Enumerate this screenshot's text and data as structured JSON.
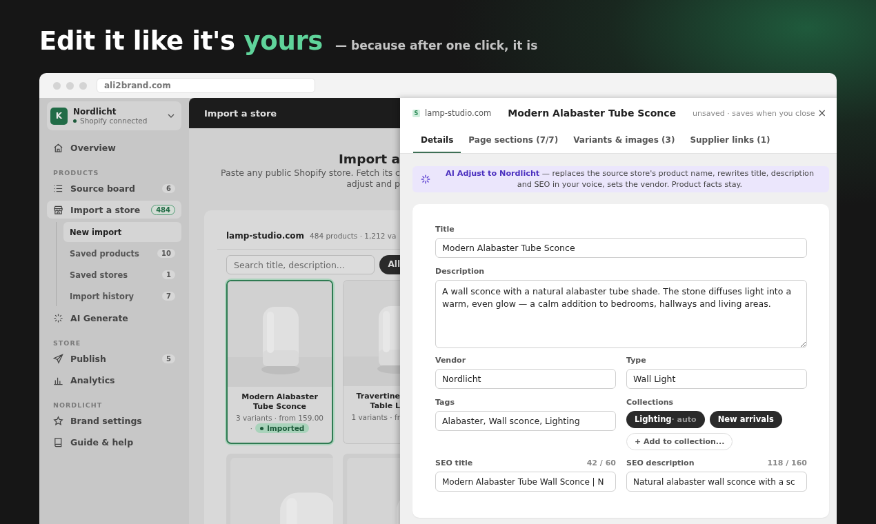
{
  "headline": {
    "parts": [
      {
        "text": "Edit it like it's",
        "accent": false
      },
      {
        "text": "yours",
        "accent": true
      }
    ],
    "tagline": "— because after one click, it is"
  },
  "browser": {
    "url": "ali2brand.com"
  },
  "sidebar": {
    "workspace": {
      "initial": "K",
      "name": "Nordlicht",
      "status": "Shopify connected"
    },
    "sections": [
      {
        "items": [
          {
            "label": "Overview",
            "selected": false
          }
        ]
      },
      {
        "heading": "PRODUCTS",
        "items": [
          {
            "label": "Source board",
            "badge": "6",
            "selected": false
          },
          {
            "label": "Import a store",
            "badge": "484",
            "selected": true,
            "children": [
              {
                "label": "New import",
                "selected": true
              },
              {
                "label": "Saved products",
                "badge": "10",
                "selected": false
              },
              {
                "label": "Saved stores",
                "badge": "1",
                "selected": false
              },
              {
                "label": "Import history",
                "badge": "7",
                "selected": false
              }
            ]
          },
          {
            "label": "AI Generate",
            "selected": false
          }
        ]
      },
      {
        "heading": "STORE",
        "items": [
          {
            "label": "Publish",
            "badge": "5",
            "selected": false
          },
          {
            "label": "Analytics",
            "selected": false
          }
        ]
      },
      {
        "heading": "NORDLICHT",
        "items": [
          {
            "label": "Brand settings",
            "selected": false
          },
          {
            "label": "Guide & help",
            "selected": false
          }
        ]
      }
    ]
  },
  "main": {
    "header_title": "Import a store",
    "title": "Import a",
    "subtitle_lines": [
      "Paste any public Shopify store. Fetch its c",
      "adjust and p"
    ],
    "store": {
      "name": "lamp-studio.com",
      "meta": "484 products · 1,212 va"
    },
    "search": {
      "placeholder": "Search title, description..."
    },
    "filter_chip": "All",
    "products": [
      {
        "kind": "full",
        "title_lines": [
          "Modern Alabaster",
          "Tube Sconce"
        ],
        "meta": "3 variants · from 159.00",
        "status_prefix": "·",
        "status": "Imported",
        "selected": true
      },
      {
        "kind": "cut",
        "title_lines": [
          "Travertine",
          "Table L"
        ],
        "meta": "1 variants · fr",
        "selected": false
      },
      {
        "kind": "picture"
      },
      {
        "kind": "picture"
      }
    ]
  },
  "panel": {
    "source_badge": "S",
    "source": "lamp-studio.com",
    "title": "Modern Alabaster Tube Sconce",
    "save_note": "unsaved · saves when you close",
    "close": "×",
    "tabs": [
      {
        "label": "Details",
        "selected": true
      },
      {
        "label": "Page sections (7/7)",
        "selected": false
      },
      {
        "label": "Variants & images (3)",
        "selected": false
      },
      {
        "label": "Supplier links (1)",
        "selected": false
      }
    ],
    "banner": "**AI Adjust to Nordlicht** — replaces the source store's product name, rewrites title, description and SEO in your voice, sets the vendor. Product facts stay.",
    "form": {
      "title": {
        "label": "Title",
        "value": "Modern Alabaster Tube Sconce"
      },
      "description": {
        "label": "Description",
        "value": "A wall sconce with a natural alabaster tube shade. The stone diffuses light into a warm, even glow — a calm addition to bedrooms, hallways and living areas."
      },
      "vendor": {
        "label": "Vendor",
        "value": "Nordlicht"
      },
      "type": {
        "label": "Type",
        "value": "Wall Light"
      },
      "tags": {
        "label": "Tags",
        "value": "Alabaster, Wall sconce, Lighting"
      },
      "collections": {
        "label": "Collections",
        "chips": [
          {
            "label": "Lighting",
            "note": "· auto"
          },
          {
            "label": "New arrivals"
          }
        ],
        "add_button": "+ Add to collection..."
      },
      "seo_title": {
        "label": "SEO title",
        "counter": "42 / 60",
        "value": "Modern Alabaster Tube Wall Sconce | N"
      },
      "seo_description": {
        "label": "SEO description",
        "counter": "118 / 160",
        "value": "Natural alabaster wall sconce with a sc"
      }
    }
  }
}
